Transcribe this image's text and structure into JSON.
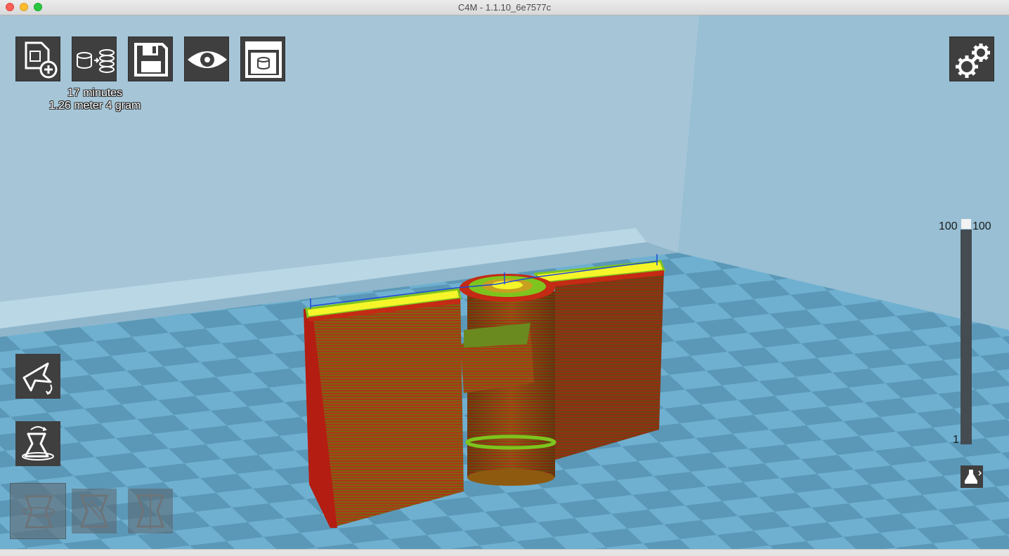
{
  "window": {
    "title": "C4M - 1.1.10_6e7577c"
  },
  "toolbar": {
    "buttons": [
      {
        "name": "load-model-button",
        "icon": "file-add-icon"
      },
      {
        "name": "slice-button",
        "icon": "slice-icon"
      },
      {
        "name": "save-button",
        "icon": "floppy-disk-icon"
      },
      {
        "name": "view-mode-button",
        "icon": "eye-icon"
      },
      {
        "name": "print-button",
        "icon": "printer-icon"
      }
    ]
  },
  "print_info": {
    "time": "17 minutes",
    "material": "1.26 meter 4 gram"
  },
  "settings": {
    "icon": "gears-icon"
  },
  "side_tools": [
    {
      "name": "rotate-tool-button",
      "icon": "rotate-icon"
    },
    {
      "name": "scale-tool-button",
      "icon": "scale-icon"
    }
  ],
  "mirror_tools": [
    {
      "name": "mirror-x-button",
      "icon": "mirror-x-icon"
    },
    {
      "name": "mirror-y-button",
      "icon": "mirror-y-icon"
    },
    {
      "name": "mirror-z-button",
      "icon": "mirror-z-icon"
    }
  ],
  "layer_slider": {
    "max_label": "100",
    "current_label": "100",
    "min_label": "1",
    "position_fraction": 1.0
  },
  "gcode_view": {
    "icon": "gcode-view-icon"
  },
  "colors": {
    "background": "#a3c4d6",
    "button": "#3f3f3f",
    "model_wall": "#8b2a0f",
    "model_top": "#f5f52a",
    "model_infill": "#7ec41e"
  }
}
